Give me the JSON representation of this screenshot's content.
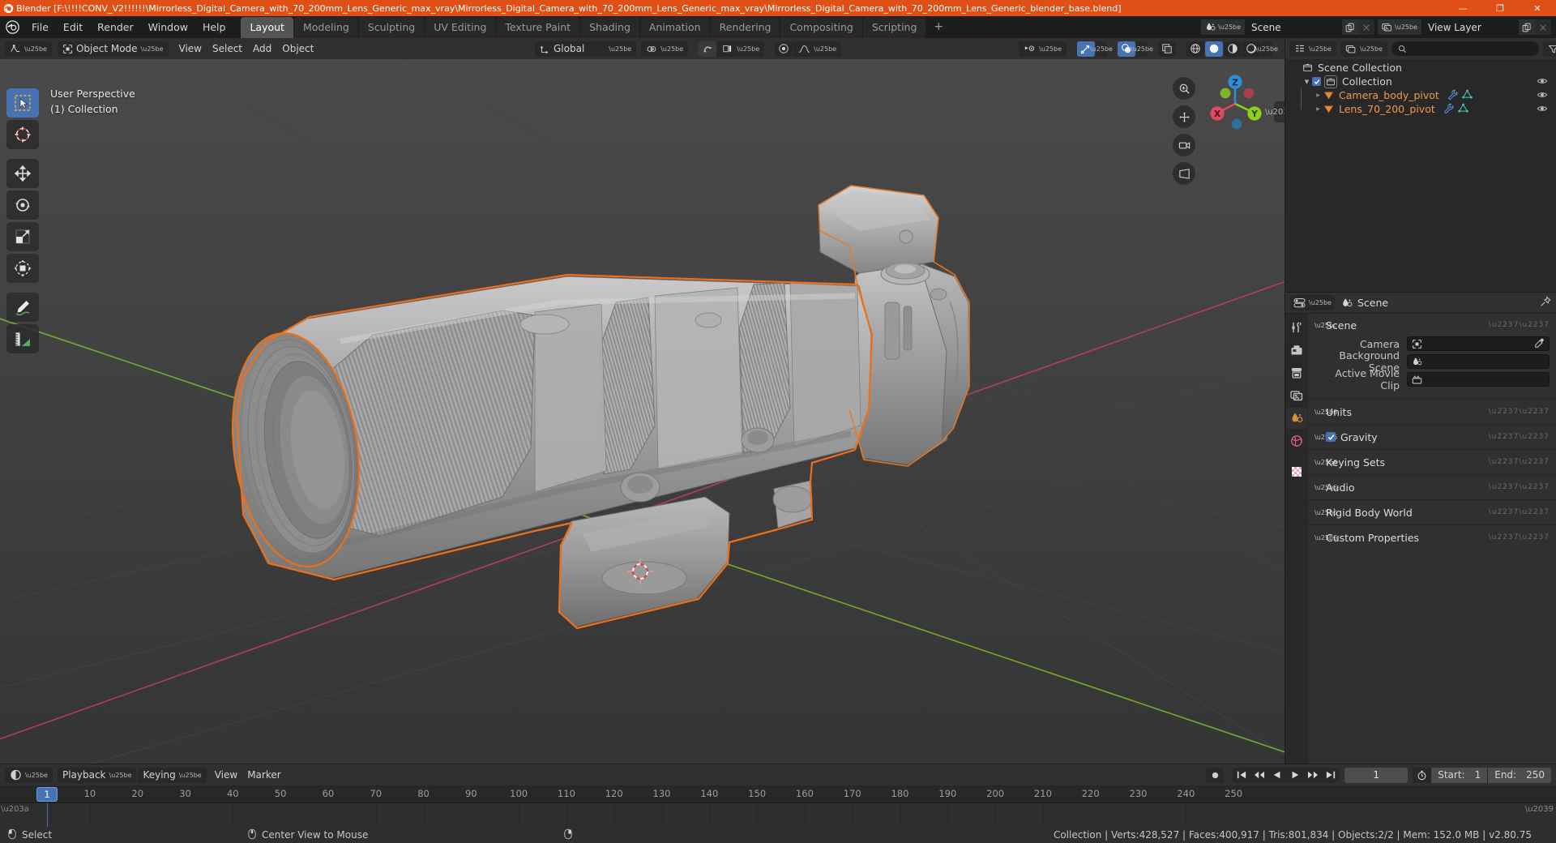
{
  "window": {
    "title": "Blender [F:\\!!!!CONV_V2!!!!!!\\Mirrorless_Digital_Camera_with_70_200mm_Lens_Generic_max_vray\\Mirrorless_Digital_Camera_with_70_200mm_Lens_Generic_max_vray\\Mirrorless_Digital_Camera_with_70_200mm_Lens_Generic_blender_base.blend]",
    "minimize": "—",
    "maximize": "❐",
    "close": "✕",
    "accent": "#e04f15"
  },
  "topbar": {
    "menus": [
      "File",
      "Edit",
      "Render",
      "Window",
      "Help"
    ],
    "workspaces": [
      {
        "label": "Layout",
        "active": true
      },
      {
        "label": "Modeling",
        "active": false
      },
      {
        "label": "Sculpting",
        "active": false
      },
      {
        "label": "UV Editing",
        "active": false
      },
      {
        "label": "Texture Paint",
        "active": false
      },
      {
        "label": "Shading",
        "active": false
      },
      {
        "label": "Animation",
        "active": false
      },
      {
        "label": "Rendering",
        "active": false
      },
      {
        "label": "Compositing",
        "active": false
      },
      {
        "label": "Scripting",
        "active": false
      }
    ],
    "add_workspace": "+",
    "scene_name": "Scene",
    "view_layer_name": "View Layer"
  },
  "viewport": {
    "mode": "Object Mode",
    "menus": [
      "View",
      "Select",
      "Add",
      "Object"
    ],
    "transform_orientation": "Global",
    "overlay_text_line1": "User Perspective",
    "overlay_text_line2": "(1) Collection",
    "gizmo_axes": {
      "x": "X",
      "y": "Y",
      "z": "Z"
    },
    "colors": {
      "x_axis": "#e0495e",
      "y_axis": "#8bd11e",
      "z_axis": "#2e8fd6",
      "selection_outline": "#ed7019",
      "background": "#3c3c3c"
    },
    "tools": [
      "tweak-select-tool",
      "cursor-tool",
      "move-tool",
      "rotate-tool",
      "scale-tool",
      "transform-tool",
      "annotate-tool",
      "measure-tool"
    ],
    "shading_modes": [
      "wireframe",
      "solid",
      "material-preview",
      "rendered"
    ],
    "active_shading": "solid"
  },
  "outliner": {
    "search_placeholder": "",
    "rows": [
      {
        "name": "Scene Collection",
        "type": "scene-collection",
        "indent": 0,
        "object": false,
        "eye": false,
        "checkbox": false,
        "disclosure": ""
      },
      {
        "name": "Collection",
        "type": "collection",
        "indent": 1,
        "object": false,
        "eye": true,
        "checkbox": true,
        "disclosure": "▼"
      },
      {
        "name": "Camera_body_pivot",
        "type": "mesh-object",
        "indent": 2,
        "object": true,
        "eye": true,
        "checkbox": false,
        "disclosure": "▶"
      },
      {
        "name": "Lens_70_200_pivot",
        "type": "mesh-object",
        "indent": 2,
        "object": true,
        "eye": true,
        "checkbox": false,
        "disclosure": "▶"
      }
    ]
  },
  "properties": {
    "breadcrumb": "Scene",
    "panels": [
      {
        "label": "Scene",
        "open": true,
        "checkbox": null
      },
      {
        "label": "Units",
        "open": false,
        "checkbox": null
      },
      {
        "label": "Gravity",
        "open": false,
        "checkbox": true
      },
      {
        "label": "Keying Sets",
        "open": false,
        "checkbox": null
      },
      {
        "label": "Audio",
        "open": false,
        "checkbox": null
      },
      {
        "label": "Rigid Body World",
        "open": false,
        "checkbox": null
      },
      {
        "label": "Custom Properties",
        "open": false,
        "checkbox": null
      }
    ],
    "scene_fields": [
      {
        "label": "Camera",
        "value": "",
        "icon": "camera-icon",
        "eyedropper": true
      },
      {
        "label": "Background Scene",
        "value": "",
        "icon": "scene-icon",
        "eyedropper": false
      },
      {
        "label": "Active Movie Clip",
        "value": "",
        "icon": "movieclip-icon",
        "eyedropper": false
      }
    ],
    "tabs": [
      "tool-icon",
      "render-icon",
      "output-icon",
      "viewlayer-icon",
      "scene-icon",
      "world-icon",
      "texture-icon"
    ],
    "active_tab": "scene-icon"
  },
  "timeline": {
    "editor_menu_icon": "timeline-editor-icon",
    "menus": [
      "Playback",
      "Keying",
      "View",
      "Marker"
    ],
    "current_frame": "1",
    "start_label": "Start:",
    "start_value": "1",
    "end_label": "End:",
    "end_value": "250",
    "ticks": [
      10,
      20,
      30,
      40,
      50,
      60,
      70,
      80,
      90,
      100,
      110,
      120,
      130,
      140,
      150,
      160,
      170,
      180,
      190,
      200,
      210,
      220,
      230,
      240,
      250
    ],
    "playhead_label": "1"
  },
  "statusbar": {
    "left_items": [
      {
        "icon": "mouse-left-icon",
        "label": "Select"
      },
      {
        "icon": "mouse-middle-icon",
        "label": "Center View to Mouse"
      },
      {
        "icon": "mouse-right-icon",
        "label": ""
      }
    ],
    "stats": "Collection | Verts:428,527 | Faces:400,917 | Tris:801,834 | Objects:2/2 | Mem: 152.0 MB | v2.80.75"
  }
}
